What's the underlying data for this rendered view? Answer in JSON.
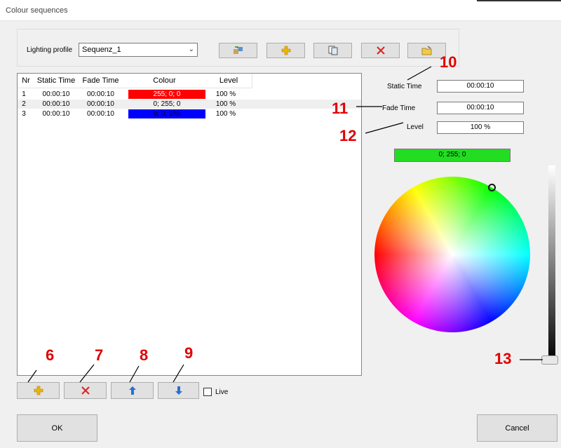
{
  "window": {
    "title": "Colour sequences"
  },
  "profile": {
    "label": "Lighting profile",
    "value": "Sequenz_1"
  },
  "toolbar": {
    "icons": [
      "swap-profile-icon",
      "add-icon",
      "copy-icon",
      "delete-icon",
      "open-folder-icon"
    ]
  },
  "table": {
    "headers": [
      "Nr",
      "Static Time",
      "Fade Time",
      "Colour",
      "Level"
    ],
    "rows": [
      {
        "nr": "1",
        "static": "00:00:10",
        "fade": "00:00:10",
        "colour": "255; 0; 0",
        "colour_hex": "#ff0000",
        "level": "100 %"
      },
      {
        "nr": "2",
        "static": "00:00:10",
        "fade": "00:00:10",
        "colour": "0; 255; 0",
        "colour_hex": "#f0f0f0",
        "level": "100 %"
      },
      {
        "nr": "3",
        "static": "00:00:10",
        "fade": "00:00:10",
        "colour": "0; 0; 255",
        "colour_hex": "#0000ff",
        "level": "100 %"
      }
    ]
  },
  "details": {
    "static_label": "Static Time",
    "static_value": "00:00:10",
    "fade_label": "Fade Time",
    "fade_value": "00:00:10",
    "level_label": "Level",
    "level_value": "100 %",
    "colour_value": "0; 255; 0",
    "colour_hex": "#22dd22"
  },
  "bottom": {
    "live_label": "Live",
    "live_checked": false,
    "ok_label": "OK",
    "cancel_label": "Cancel"
  },
  "annotations": [
    "6",
    "7",
    "8",
    "9",
    "10",
    "11",
    "12",
    "13"
  ],
  "colors": {
    "annotation": "#e00000",
    "accent_plus": "#f0b400",
    "accent_delete": "#e02020",
    "accent_arrow": "#2a6fd6"
  }
}
